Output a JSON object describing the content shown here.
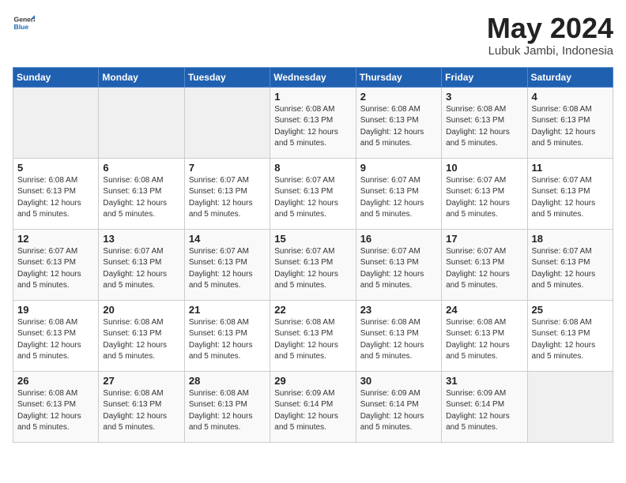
{
  "logo": {
    "general": "General",
    "blue": "Blue"
  },
  "title": {
    "month_year": "May 2024",
    "location": "Lubuk Jambi, Indonesia"
  },
  "headers": [
    "Sunday",
    "Monday",
    "Tuesday",
    "Wednesday",
    "Thursday",
    "Friday",
    "Saturday"
  ],
  "weeks": [
    [
      {
        "day": "",
        "info": ""
      },
      {
        "day": "",
        "info": ""
      },
      {
        "day": "",
        "info": ""
      },
      {
        "day": "1",
        "info": "Sunrise: 6:08 AM\nSunset: 6:13 PM\nDaylight: 12 hours\nand 5 minutes."
      },
      {
        "day": "2",
        "info": "Sunrise: 6:08 AM\nSunset: 6:13 PM\nDaylight: 12 hours\nand 5 minutes."
      },
      {
        "day": "3",
        "info": "Sunrise: 6:08 AM\nSunset: 6:13 PM\nDaylight: 12 hours\nand 5 minutes."
      },
      {
        "day": "4",
        "info": "Sunrise: 6:08 AM\nSunset: 6:13 PM\nDaylight: 12 hours\nand 5 minutes."
      }
    ],
    [
      {
        "day": "5",
        "info": "Sunrise: 6:08 AM\nSunset: 6:13 PM\nDaylight: 12 hours\nand 5 minutes."
      },
      {
        "day": "6",
        "info": "Sunrise: 6:08 AM\nSunset: 6:13 PM\nDaylight: 12 hours\nand 5 minutes."
      },
      {
        "day": "7",
        "info": "Sunrise: 6:07 AM\nSunset: 6:13 PM\nDaylight: 12 hours\nand 5 minutes."
      },
      {
        "day": "8",
        "info": "Sunrise: 6:07 AM\nSunset: 6:13 PM\nDaylight: 12 hours\nand 5 minutes."
      },
      {
        "day": "9",
        "info": "Sunrise: 6:07 AM\nSunset: 6:13 PM\nDaylight: 12 hours\nand 5 minutes."
      },
      {
        "day": "10",
        "info": "Sunrise: 6:07 AM\nSunset: 6:13 PM\nDaylight: 12 hours\nand 5 minutes."
      },
      {
        "day": "11",
        "info": "Sunrise: 6:07 AM\nSunset: 6:13 PM\nDaylight: 12 hours\nand 5 minutes."
      }
    ],
    [
      {
        "day": "12",
        "info": "Sunrise: 6:07 AM\nSunset: 6:13 PM\nDaylight: 12 hours\nand 5 minutes."
      },
      {
        "day": "13",
        "info": "Sunrise: 6:07 AM\nSunset: 6:13 PM\nDaylight: 12 hours\nand 5 minutes."
      },
      {
        "day": "14",
        "info": "Sunrise: 6:07 AM\nSunset: 6:13 PM\nDaylight: 12 hours\nand 5 minutes."
      },
      {
        "day": "15",
        "info": "Sunrise: 6:07 AM\nSunset: 6:13 PM\nDaylight: 12 hours\nand 5 minutes."
      },
      {
        "day": "16",
        "info": "Sunrise: 6:07 AM\nSunset: 6:13 PM\nDaylight: 12 hours\nand 5 minutes."
      },
      {
        "day": "17",
        "info": "Sunrise: 6:07 AM\nSunset: 6:13 PM\nDaylight: 12 hours\nand 5 minutes."
      },
      {
        "day": "18",
        "info": "Sunrise: 6:07 AM\nSunset: 6:13 PM\nDaylight: 12 hours\nand 5 minutes."
      }
    ],
    [
      {
        "day": "19",
        "info": "Sunrise: 6:08 AM\nSunset: 6:13 PM\nDaylight: 12 hours\nand 5 minutes."
      },
      {
        "day": "20",
        "info": "Sunrise: 6:08 AM\nSunset: 6:13 PM\nDaylight: 12 hours\nand 5 minutes."
      },
      {
        "day": "21",
        "info": "Sunrise: 6:08 AM\nSunset: 6:13 PM\nDaylight: 12 hours\nand 5 minutes."
      },
      {
        "day": "22",
        "info": "Sunrise: 6:08 AM\nSunset: 6:13 PM\nDaylight: 12 hours\nand 5 minutes."
      },
      {
        "day": "23",
        "info": "Sunrise: 6:08 AM\nSunset: 6:13 PM\nDaylight: 12 hours\nand 5 minutes."
      },
      {
        "day": "24",
        "info": "Sunrise: 6:08 AM\nSunset: 6:13 PM\nDaylight: 12 hours\nand 5 minutes."
      },
      {
        "day": "25",
        "info": "Sunrise: 6:08 AM\nSunset: 6:13 PM\nDaylight: 12 hours\nand 5 minutes."
      }
    ],
    [
      {
        "day": "26",
        "info": "Sunrise: 6:08 AM\nSunset: 6:13 PM\nDaylight: 12 hours\nand 5 minutes."
      },
      {
        "day": "27",
        "info": "Sunrise: 6:08 AM\nSunset: 6:13 PM\nDaylight: 12 hours\nand 5 minutes."
      },
      {
        "day": "28",
        "info": "Sunrise: 6:08 AM\nSunset: 6:13 PM\nDaylight: 12 hours\nand 5 minutes."
      },
      {
        "day": "29",
        "info": "Sunrise: 6:09 AM\nSunset: 6:14 PM\nDaylight: 12 hours\nand 5 minutes."
      },
      {
        "day": "30",
        "info": "Sunrise: 6:09 AM\nSunset: 6:14 PM\nDaylight: 12 hours\nand 5 minutes."
      },
      {
        "day": "31",
        "info": "Sunrise: 6:09 AM\nSunset: 6:14 PM\nDaylight: 12 hours\nand 5 minutes."
      },
      {
        "day": "",
        "info": ""
      }
    ]
  ]
}
